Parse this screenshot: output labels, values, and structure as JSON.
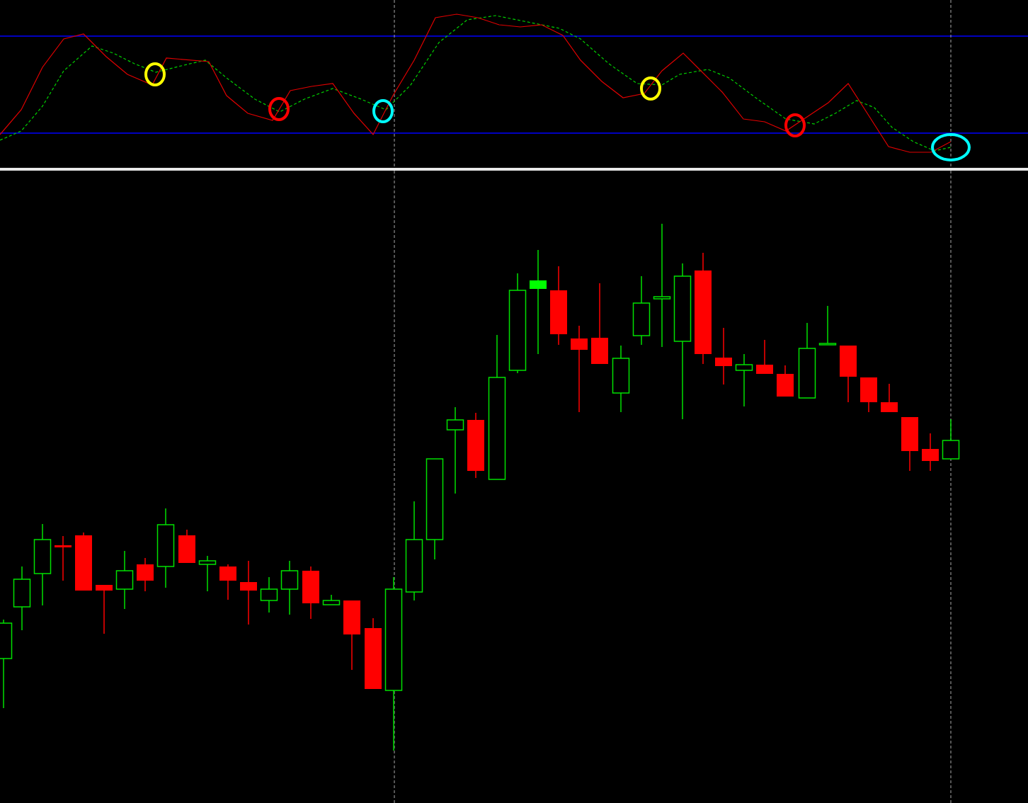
{
  "oscillator_panel": {
    "markers": [
      {
        "color": "#ffff00"
      },
      {
        "color": "#ff0000"
      },
      {
        "color": "#00ffff"
      },
      {
        "color": "#ffff00"
      },
      {
        "color": "#ff0000"
      },
      {
        "color": "#00ffff"
      }
    ]
  },
  "price_panel": {
    "candles": [
      {
        "kind": "bull"
      },
      {
        "kind": "bull"
      },
      {
        "kind": "bull"
      },
      {
        "kind": "bear"
      },
      {
        "kind": "bear"
      },
      {
        "kind": "bear"
      },
      {
        "kind": "bull"
      },
      {
        "kind": "bear"
      },
      {
        "kind": "bull"
      },
      {
        "kind": "bear"
      },
      {
        "kind": "bull"
      },
      {
        "kind": "bear"
      },
      {
        "kind": "bear"
      },
      {
        "kind": "bull"
      },
      {
        "kind": "bull"
      },
      {
        "kind": "bear"
      },
      {
        "kind": "bull"
      },
      {
        "kind": "bear"
      },
      {
        "kind": "bear"
      },
      {
        "kind": "bull"
      },
      {
        "kind": "bull"
      },
      {
        "kind": "bull"
      },
      {
        "kind": "bull"
      },
      {
        "kind": "bear"
      },
      {
        "kind": "bull"
      },
      {
        "kind": "bull"
      },
      {
        "kind": "marked"
      },
      {
        "kind": "bear"
      },
      {
        "kind": "bear"
      },
      {
        "kind": "bear"
      },
      {
        "kind": "bull"
      },
      {
        "kind": "bull"
      },
      {
        "kind": "bull"
      },
      {
        "kind": "bull"
      },
      {
        "kind": "bear"
      },
      {
        "kind": "bear"
      },
      {
        "kind": "bull"
      },
      {
        "kind": "bear"
      },
      {
        "kind": "bear"
      },
      {
        "kind": "bull"
      },
      {
        "kind": "bull"
      },
      {
        "kind": "bear"
      },
      {
        "kind": "bear"
      },
      {
        "kind": "bear"
      },
      {
        "kind": "bear"
      },
      {
        "kind": "bear"
      },
      {
        "kind": "bull"
      }
    ]
  }
}
